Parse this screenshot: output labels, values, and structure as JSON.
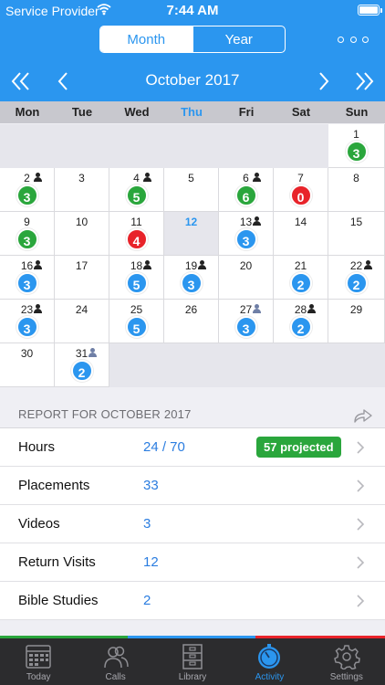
{
  "status": {
    "carrier": "Service Provider",
    "time": "7:44 AM"
  },
  "segments": {
    "month": "Month",
    "year": "Year"
  },
  "nav": {
    "month_title": "October 2017"
  },
  "weekdays": [
    "Mon",
    "Tue",
    "Wed",
    "Thu",
    "Fri",
    "Sat",
    "Sun"
  ],
  "today": "12",
  "colors": {
    "accent": "#2b96ef",
    "green": "#2aa63c",
    "red": "#e8232a",
    "blue": "#2b96ef"
  },
  "calendar": [
    {
      "day": "",
      "badge": null
    },
    {
      "day": "",
      "badge": null
    },
    {
      "day": "",
      "badge": null
    },
    {
      "day": "",
      "badge": null
    },
    {
      "day": "",
      "badge": null
    },
    {
      "day": "",
      "badge": null
    },
    {
      "day": "1",
      "badge": "3",
      "color": "green",
      "person": false
    },
    {
      "day": "2",
      "badge": "3",
      "color": "green",
      "person": true
    },
    {
      "day": "3",
      "badge": null,
      "person": false
    },
    {
      "day": "4",
      "badge": "5",
      "color": "green",
      "person": true
    },
    {
      "day": "5",
      "badge": null,
      "person": false
    },
    {
      "day": "6",
      "badge": "6",
      "color": "green",
      "person": true
    },
    {
      "day": "7",
      "badge": "0",
      "color": "red",
      "person": false
    },
    {
      "day": "8",
      "badge": null,
      "person": false
    },
    {
      "day": "9",
      "badge": "3",
      "color": "green",
      "person": false
    },
    {
      "day": "10",
      "badge": null,
      "person": false
    },
    {
      "day": "11",
      "badge": "4",
      "color": "red",
      "person": false
    },
    {
      "day": "12",
      "badge": null,
      "person": false,
      "today": true
    },
    {
      "day": "13",
      "badge": "3",
      "color": "blue",
      "person": true
    },
    {
      "day": "14",
      "badge": null,
      "person": false
    },
    {
      "day": "15",
      "badge": null,
      "person": false
    },
    {
      "day": "16",
      "badge": "3",
      "color": "blue",
      "person": true
    },
    {
      "day": "17",
      "badge": null,
      "person": false
    },
    {
      "day": "18",
      "badge": "5",
      "color": "blue",
      "person": true
    },
    {
      "day": "19",
      "badge": "3",
      "color": "blue",
      "person": true
    },
    {
      "day": "20",
      "badge": null,
      "person": false
    },
    {
      "day": "21",
      "badge": "2",
      "color": "blue",
      "person": false
    },
    {
      "day": "22",
      "badge": "2",
      "color": "blue",
      "person": true
    },
    {
      "day": "23",
      "badge": "3",
      "color": "blue",
      "person": true
    },
    {
      "day": "24",
      "badge": null,
      "person": false
    },
    {
      "day": "25",
      "badge": "5",
      "color": "blue",
      "person": false
    },
    {
      "day": "26",
      "badge": null,
      "person": false
    },
    {
      "day": "27",
      "badge": "3",
      "color": "blue",
      "person": "faded"
    },
    {
      "day": "28",
      "badge": "2",
      "color": "blue",
      "person": true
    },
    {
      "day": "29",
      "badge": null,
      "person": false
    },
    {
      "day": "30",
      "badge": null,
      "person": false
    },
    {
      "day": "31",
      "badge": "2",
      "color": "blue",
      "person": "faded"
    }
  ],
  "report": {
    "header": "REPORT FOR OCTOBER 2017",
    "rows": [
      {
        "label": "Hours",
        "value": "24 / 70",
        "projected": "57 projected"
      },
      {
        "label": "Placements",
        "value": "33"
      },
      {
        "label": "Videos",
        "value": "3"
      },
      {
        "label": "Return Visits",
        "value": "12"
      },
      {
        "label": "Bible Studies",
        "value": "2"
      }
    ]
  },
  "strip_colors": [
    "#2aa63c",
    "#2b96ef",
    "#e8232a"
  ],
  "tabs": [
    {
      "label": "Today",
      "icon": "calendar-icon"
    },
    {
      "label": "Calls",
      "icon": "people-icon"
    },
    {
      "label": "Library",
      "icon": "cabinet-icon"
    },
    {
      "label": "Activity",
      "icon": "stopwatch-icon",
      "active": true
    },
    {
      "label": "Settings",
      "icon": "gear-icon"
    }
  ]
}
